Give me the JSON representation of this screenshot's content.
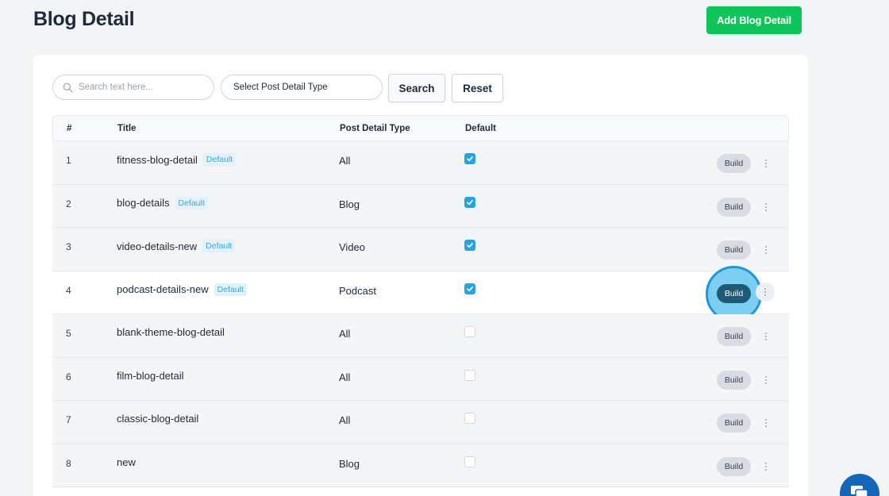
{
  "header": {
    "title": "Blog Detail",
    "add_button": "Add Blog Detail"
  },
  "filters": {
    "search_placeholder": "Search text here...",
    "type_select": "Select Post Detail Type",
    "search_button": "Search",
    "reset_button": "Reset"
  },
  "table": {
    "columns": [
      "#",
      "Title",
      "Post Detail Type",
      "Default"
    ],
    "build_label": "Build",
    "badge_label": "Default",
    "rows": [
      {
        "num": "1",
        "title": "fitness-blog-detail",
        "badge": true,
        "type": "All",
        "default": true
      },
      {
        "num": "2",
        "title": "blog-details",
        "badge": true,
        "type": "Blog",
        "default": true
      },
      {
        "num": "3",
        "title": "video-details-new",
        "badge": true,
        "type": "Video",
        "default": true
      },
      {
        "num": "4",
        "title": "podcast-details-new",
        "badge": true,
        "type": "Podcast",
        "default": true,
        "active": true
      },
      {
        "num": "5",
        "title": "blank-theme-blog-detail",
        "badge": false,
        "type": "All",
        "default": false
      },
      {
        "num": "6",
        "title": "film-blog-detail",
        "badge": false,
        "type": "All",
        "default": false
      },
      {
        "num": "7",
        "title": "classic-blog-detail",
        "badge": false,
        "type": "All",
        "default": false
      },
      {
        "num": "8",
        "title": "new",
        "badge": false,
        "type": "Blog",
        "default": false
      }
    ]
  },
  "colors": {
    "primary_green": "#10c45c",
    "checkbox_blue": "#29a3dd",
    "badge_text": "#38a8d8",
    "active_build": "#1e5a78",
    "chat_button": "#1566b8"
  },
  "icons": {
    "search": "search-icon",
    "check": "check-icon",
    "more": "more-vertical-icon",
    "chat": "chat-icon"
  }
}
